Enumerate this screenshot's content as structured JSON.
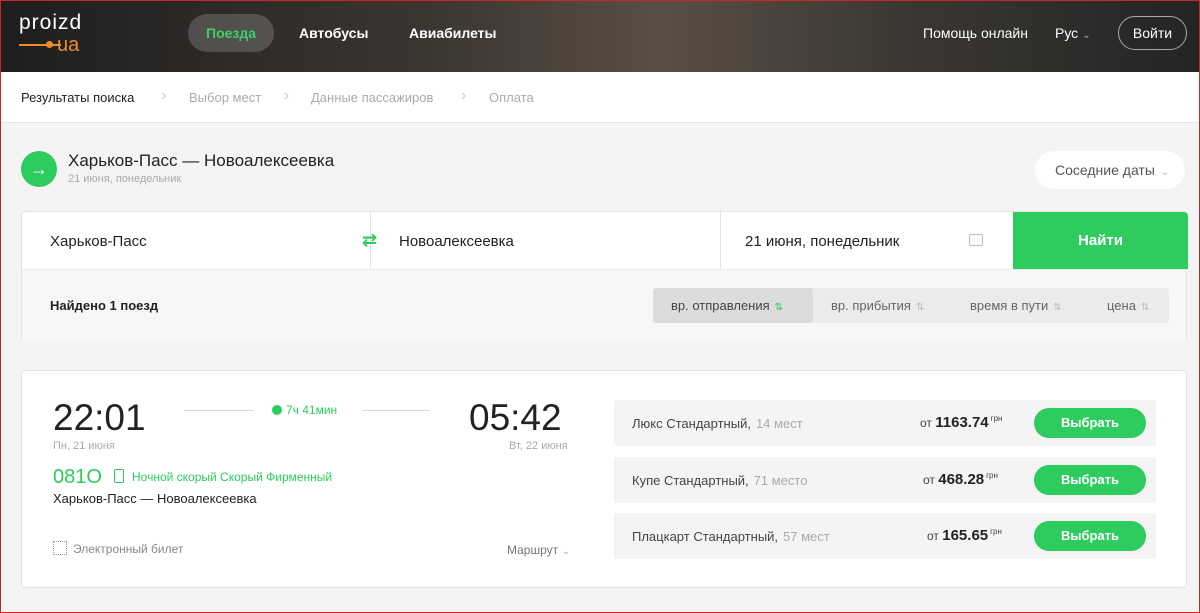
{
  "header": {
    "logo_top": "proizd",
    "logo_bottom": "ua",
    "tabs": [
      "Поезда",
      "Автобусы",
      "Авиабилеты"
    ],
    "help": "Помощь онлайн",
    "lang": "Рус",
    "login": "Войти"
  },
  "breadcrumbs": [
    "Результаты поиска",
    "Выбор мест",
    "Данные пассажиров",
    "Оплата"
  ],
  "route": {
    "title": "Харьков-Пасс — Новоалексеевка",
    "date": "21 июня, понедельник",
    "nearby_dates": "Соседние даты"
  },
  "search": {
    "from": "Харьков-Пасс",
    "to": "Новоалексеевка",
    "date": "21 июня, понедельник",
    "find": "Найти"
  },
  "results": {
    "found": "Найдено 1 поезд",
    "sort_options": [
      "вр. отправления",
      "вр. прибытия",
      "время в пути",
      "цена"
    ]
  },
  "train": {
    "departure_time": "22:01",
    "departure_date": "Пн, 21 июня",
    "duration": "7ч 41мин",
    "arrival_time": "05:42",
    "arrival_date": "Вт, 22 июня",
    "number": "081О",
    "tags": "Ночной скорый Скорый Фирменный",
    "route": "Харьков-Пасс — Новоалексеевка",
    "eticket": "Электронный билет",
    "route_link": "Маршрут",
    "classes": [
      {
        "name": "Люкс Стандартный,",
        "seats": "14 мест",
        "prefix": "от",
        "price": "1163.74",
        "currency": "грн",
        "button": "Выбрать"
      },
      {
        "name": "Купе Стандартный,",
        "seats": "71 место",
        "prefix": "от",
        "price": "468.28",
        "currency": "грн",
        "button": "Выбрать"
      },
      {
        "name": "Плацкарт Стандартный,",
        "seats": "57 мест",
        "prefix": "от",
        "price": "165.65",
        "currency": "грн",
        "button": "Выбрать"
      }
    ]
  },
  "colors": {
    "accent": "#2ecc5f",
    "logo": "#f08a24"
  },
  "icons": [
    "arrow-right-icon",
    "swap-icon",
    "calendar-icon",
    "clock-icon",
    "train-icon",
    "qr-code-icon",
    "chevron-down-icon"
  ]
}
